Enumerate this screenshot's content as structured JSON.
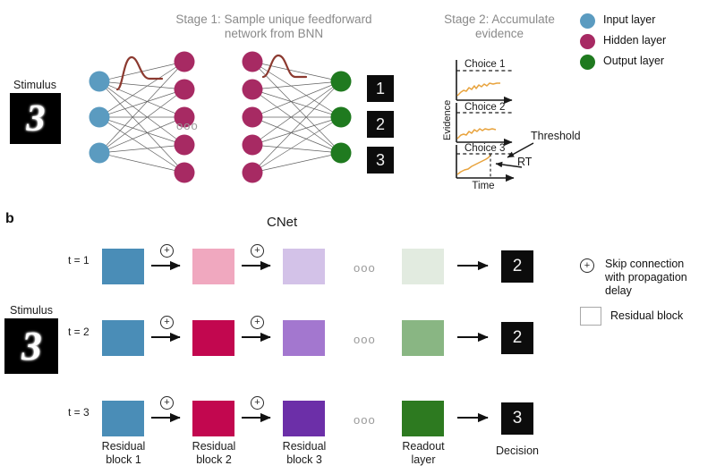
{
  "figure": {
    "panel_a_letter": "",
    "panel_b_letter": "b"
  },
  "panel_a": {
    "stage1_title": "Stage 1: Sample unique feedforward\nnetwork from BNN",
    "stage1_title_line1": "Stage 1: Sample unique feedforward",
    "stage1_title_line2": "network from BNN",
    "stage2_title_line1": "Stage 2: Accumulate",
    "stage2_title_line2": "evidence",
    "stimulus_label": "Stimulus",
    "stimulus_digit": "3",
    "ellipsis": "ooo",
    "decision_boxes": [
      "1",
      "2",
      "3"
    ],
    "legend": [
      {
        "label": "Input layer",
        "color": "#5b9bc0",
        "icon": "circle-icon"
      },
      {
        "label": "Hidden layer",
        "color": "#a72a63",
        "icon": "circle-icon"
      },
      {
        "label": "Output layer",
        "color": "#1f7a1f",
        "icon": "circle-icon"
      }
    ],
    "network": {
      "input_nodes": 3,
      "hidden_nodes": 5,
      "output_nodes": 3,
      "input_color": "#5b9bc0",
      "hidden_color": "#a72a63",
      "output_color": "#1f7a1f",
      "edge_color": "#5a5a5a",
      "distribution_curve_color": "#8c3a30"
    },
    "evidence_plot": {
      "ylabel": "Evidence",
      "xlabel": "Time",
      "trace_color": "#e8a33d",
      "axis_color": "#1a1a1a",
      "threshold_style": "dashed",
      "panels": [
        {
          "label": "Choice 1",
          "reaches_threshold": false
        },
        {
          "label": "Choice 2",
          "reaches_threshold": false
        },
        {
          "label": "Choice 3",
          "reaches_threshold": true
        }
      ],
      "annotations": [
        {
          "label": "Threshold"
        },
        {
          "label": "RT"
        }
      ]
    }
  },
  "panel_b": {
    "title": "CNet",
    "stimulus_label": "Stimulus",
    "stimulus_digit": "3",
    "ellipsis": "ooo",
    "time_labels": [
      "t = 1",
      "t = 2",
      "t = 3"
    ],
    "column_labels": [
      "Residual\nblock 1",
      "Residual\nblock 2",
      "Residual\nblock 3",
      "Readout\nlayer",
      "Decision"
    ],
    "column_labels_lines": [
      [
        "Residual",
        "block 1"
      ],
      [
        "Residual",
        "block 2"
      ],
      [
        "Residual",
        "block 3"
      ],
      [
        "Readout",
        "layer"
      ],
      [
        "Decision"
      ]
    ],
    "rows": [
      {
        "time": "t = 1",
        "blocks": [
          "#4a8db7",
          "#f0a8bf",
          "#d3c2e8",
          "#e2ebe0"
        ],
        "decision": "2"
      },
      {
        "time": "t = 2",
        "blocks": [
          "#4a8db7",
          "#c2074f",
          "#a377cf",
          "#89b683"
        ],
        "decision": "2"
      },
      {
        "time": "t = 3",
        "blocks": [
          "#4a8db7",
          "#c2074f",
          "#6c2fa8",
          "#2d7a20"
        ],
        "decision": "3"
      }
    ],
    "legend": [
      {
        "icon": "circled-plus-icon",
        "glyph": "+",
        "label_lines": [
          "Skip connection",
          "with propagation",
          "delay"
        ],
        "label": "Skip connection with propagation delay"
      },
      {
        "icon": "square-outline-icon",
        "glyph": "",
        "label_lines": [
          "Residual block"
        ],
        "label": "Residual block"
      }
    ]
  },
  "colors": {
    "input_layer": "#5b9bc0",
    "hidden_layer": "#a72a63",
    "output_layer": "#1f7a1f",
    "trace": "#e8a33d",
    "curve": "#8c3a30",
    "title_grey": "#8a8a8a",
    "text_dark": "#1a1a1a",
    "decision_bg": "#0c0c0c"
  }
}
